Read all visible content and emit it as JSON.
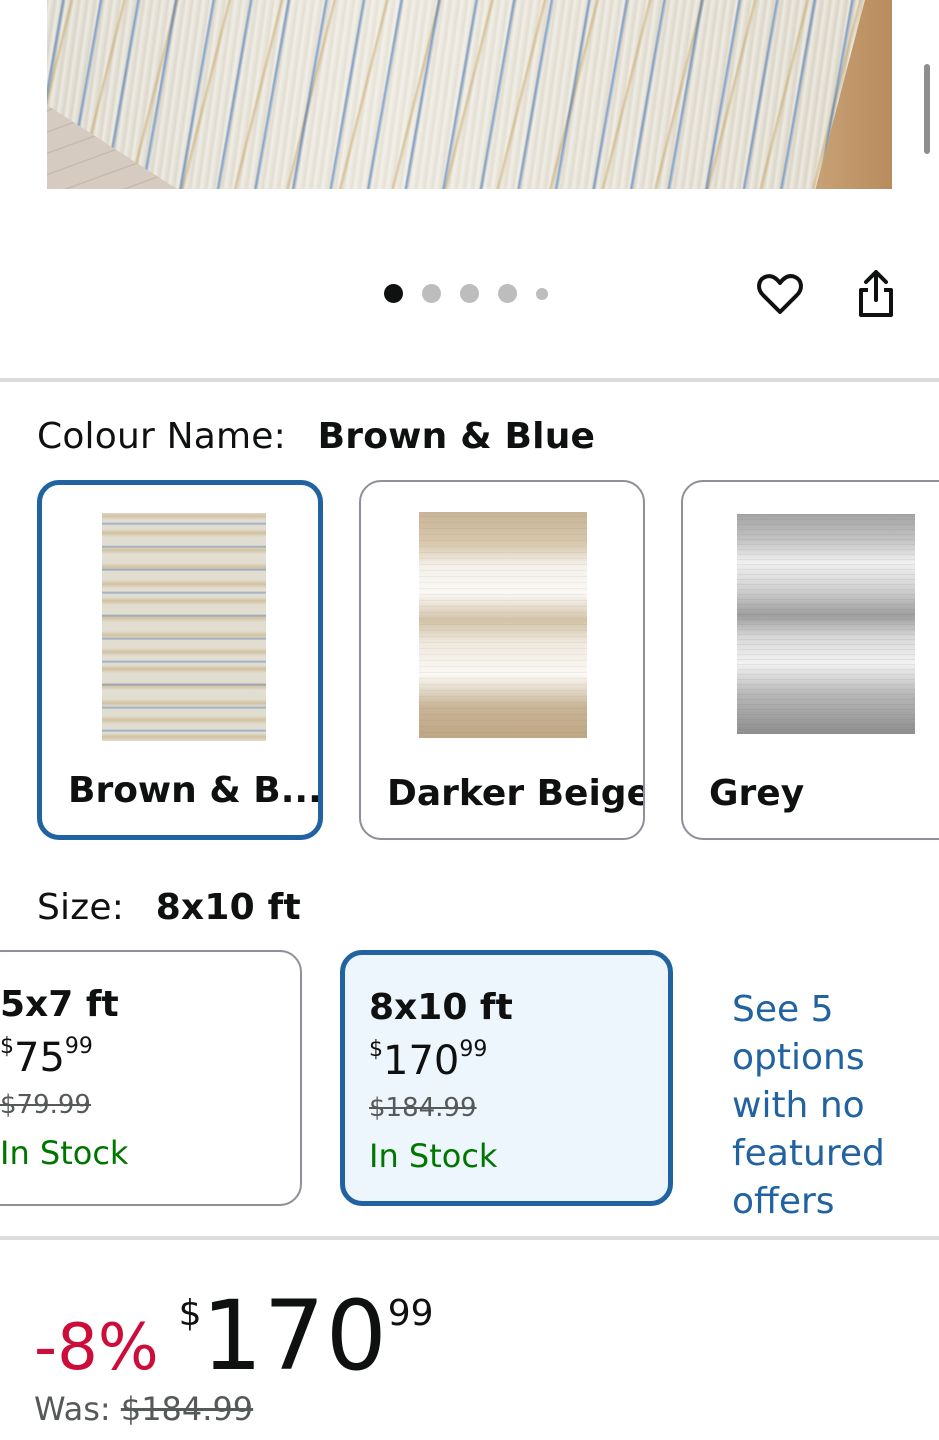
{
  "gallery": {
    "dot_count": 5,
    "active_dot": 0,
    "actions": [
      {
        "name": "heart-icon"
      },
      {
        "name": "share-icon"
      }
    ]
  },
  "colour": {
    "label": "Colour Name:",
    "selected_value": "Brown & Blue",
    "options": [
      {
        "label": "Brown & B...",
        "selected": true
      },
      {
        "label": "Darker Beige",
        "selected": false
      },
      {
        "label": "Grey",
        "selected": false
      }
    ]
  },
  "size": {
    "label": "Size:",
    "selected_value": "8x10 ft",
    "options": [
      {
        "size": "5x7 ft",
        "currency": "$",
        "whole": "75",
        "fraction": "99",
        "was": "$79.99",
        "stock": "In Stock",
        "selected": false
      },
      {
        "size": "8x10 ft",
        "currency": "$",
        "whole": "170",
        "fraction": "99",
        "was": "$184.99",
        "stock": "In Stock",
        "selected": true
      }
    ],
    "see_more": "See 5 options with no featured offers"
  },
  "price": {
    "discount": "-8%",
    "currency": "$",
    "whole": "170",
    "fraction": "99",
    "was_label": "Was:",
    "was_value": "$184.99"
  },
  "colors": {
    "accent": "#2162a1",
    "discount": "#cc0c39",
    "in_stock": "#007600"
  }
}
